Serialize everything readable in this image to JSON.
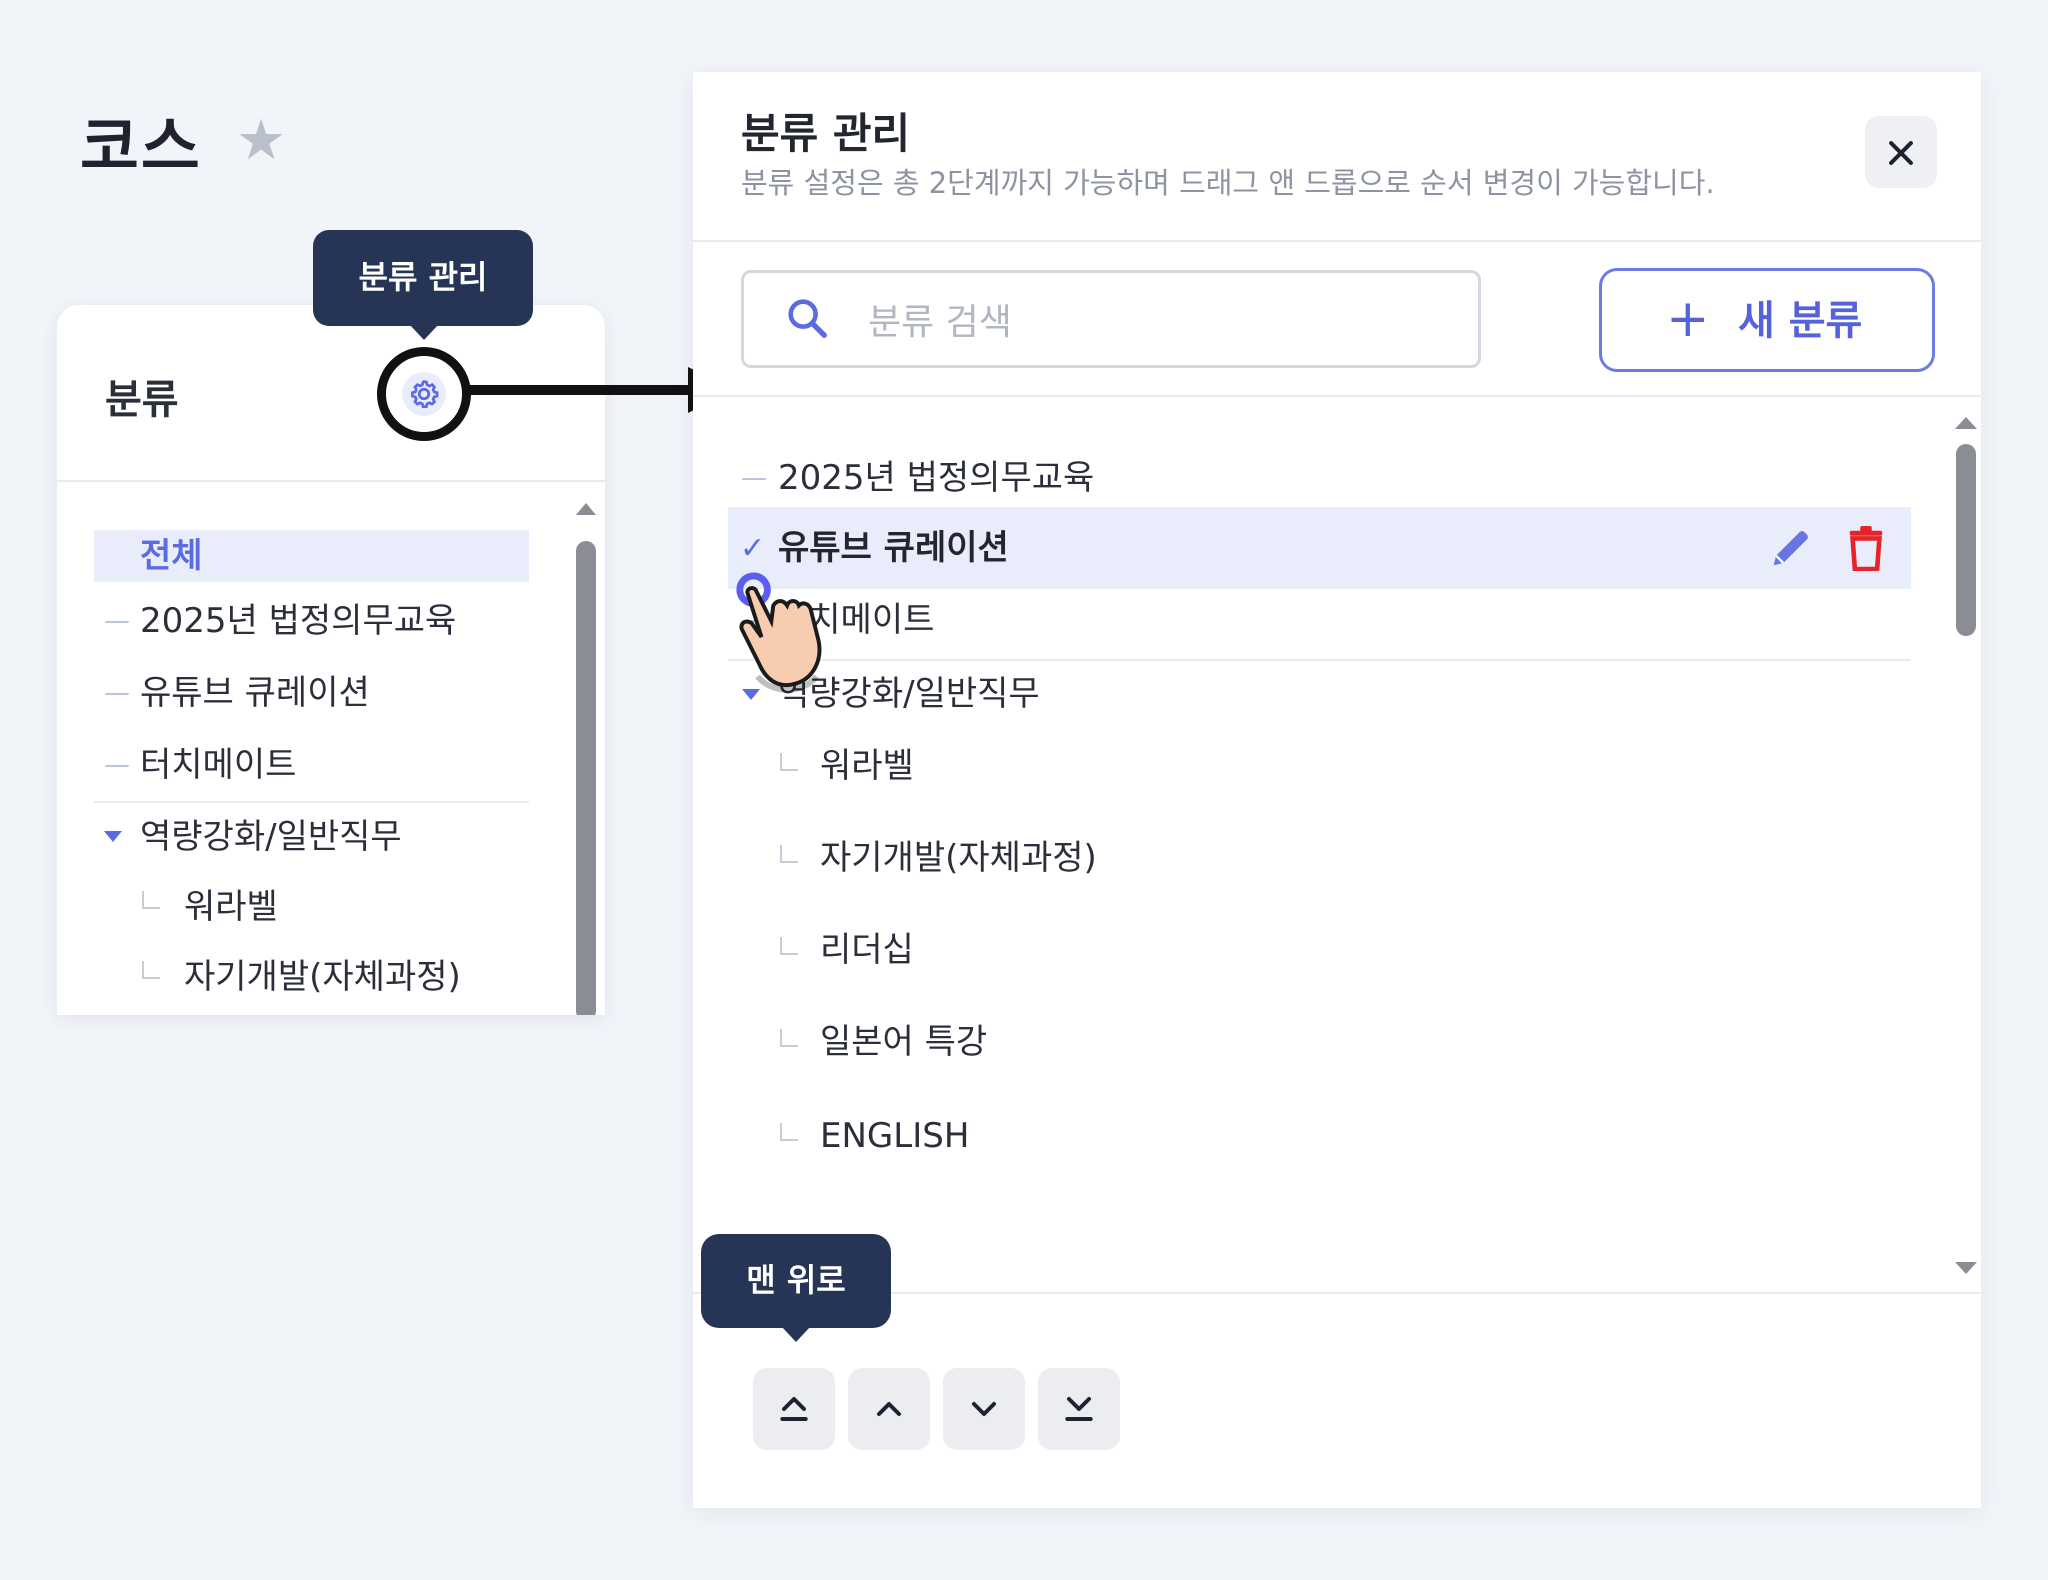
{
  "page": {
    "title": "코스",
    "favorite_icon": "star-icon"
  },
  "left_panel": {
    "header_title": "분류",
    "settings_icon": "gear-icon",
    "tooltip": "분류 관리",
    "items": [
      {
        "label": "전체",
        "selected": true
      },
      {
        "label": "2025년 법정의무교육"
      },
      {
        "label": "유튜브 큐레이션"
      },
      {
        "label": "터치메이트"
      },
      {
        "label": "역량강화/일반직무",
        "expanded": true
      },
      {
        "label": "워라벨",
        "child": true
      },
      {
        "label": "자기개발(자체과정)",
        "child": true
      }
    ]
  },
  "modal": {
    "title": "분류 관리",
    "description": "분류 설정은 총 2단계까지 가능하며 드래그 앤 드롭으로 순서 변경이 가능합니다.",
    "close_icon": "close-icon",
    "search": {
      "placeholder": "분류 검색",
      "value": ""
    },
    "new_button": {
      "icon": "plus-icon",
      "label": "새 분류"
    },
    "tree": [
      {
        "label": "2025년 법정의무교육"
      },
      {
        "label": "유튜브 큐레이션",
        "selected": true
      },
      {
        "label": "터치메이트"
      },
      {
        "label": "역량강화/일반직무",
        "expanded": true
      },
      {
        "label": "워라벨",
        "child": true
      },
      {
        "label": "자기개발(자체과정)",
        "child": true
      },
      {
        "label": "리더십",
        "child": true
      },
      {
        "label": "일본어 특강",
        "child": true
      },
      {
        "label": "ENGLISH",
        "child": true
      }
    ],
    "row_actions": {
      "edit_icon": "pencil-icon",
      "delete_icon": "trash-icon"
    },
    "move_tooltip": "맨 위로",
    "move_buttons": [
      "move-to-top-icon",
      "move-up-icon",
      "move-down-icon",
      "move-to-bottom-icon"
    ]
  },
  "colors": {
    "accent": "#5b6be0",
    "tooltip_bg": "#263556",
    "danger": "#e5232b",
    "selected_row_bg": "#e8ecfb",
    "page_bg": "#f1f4f9"
  }
}
